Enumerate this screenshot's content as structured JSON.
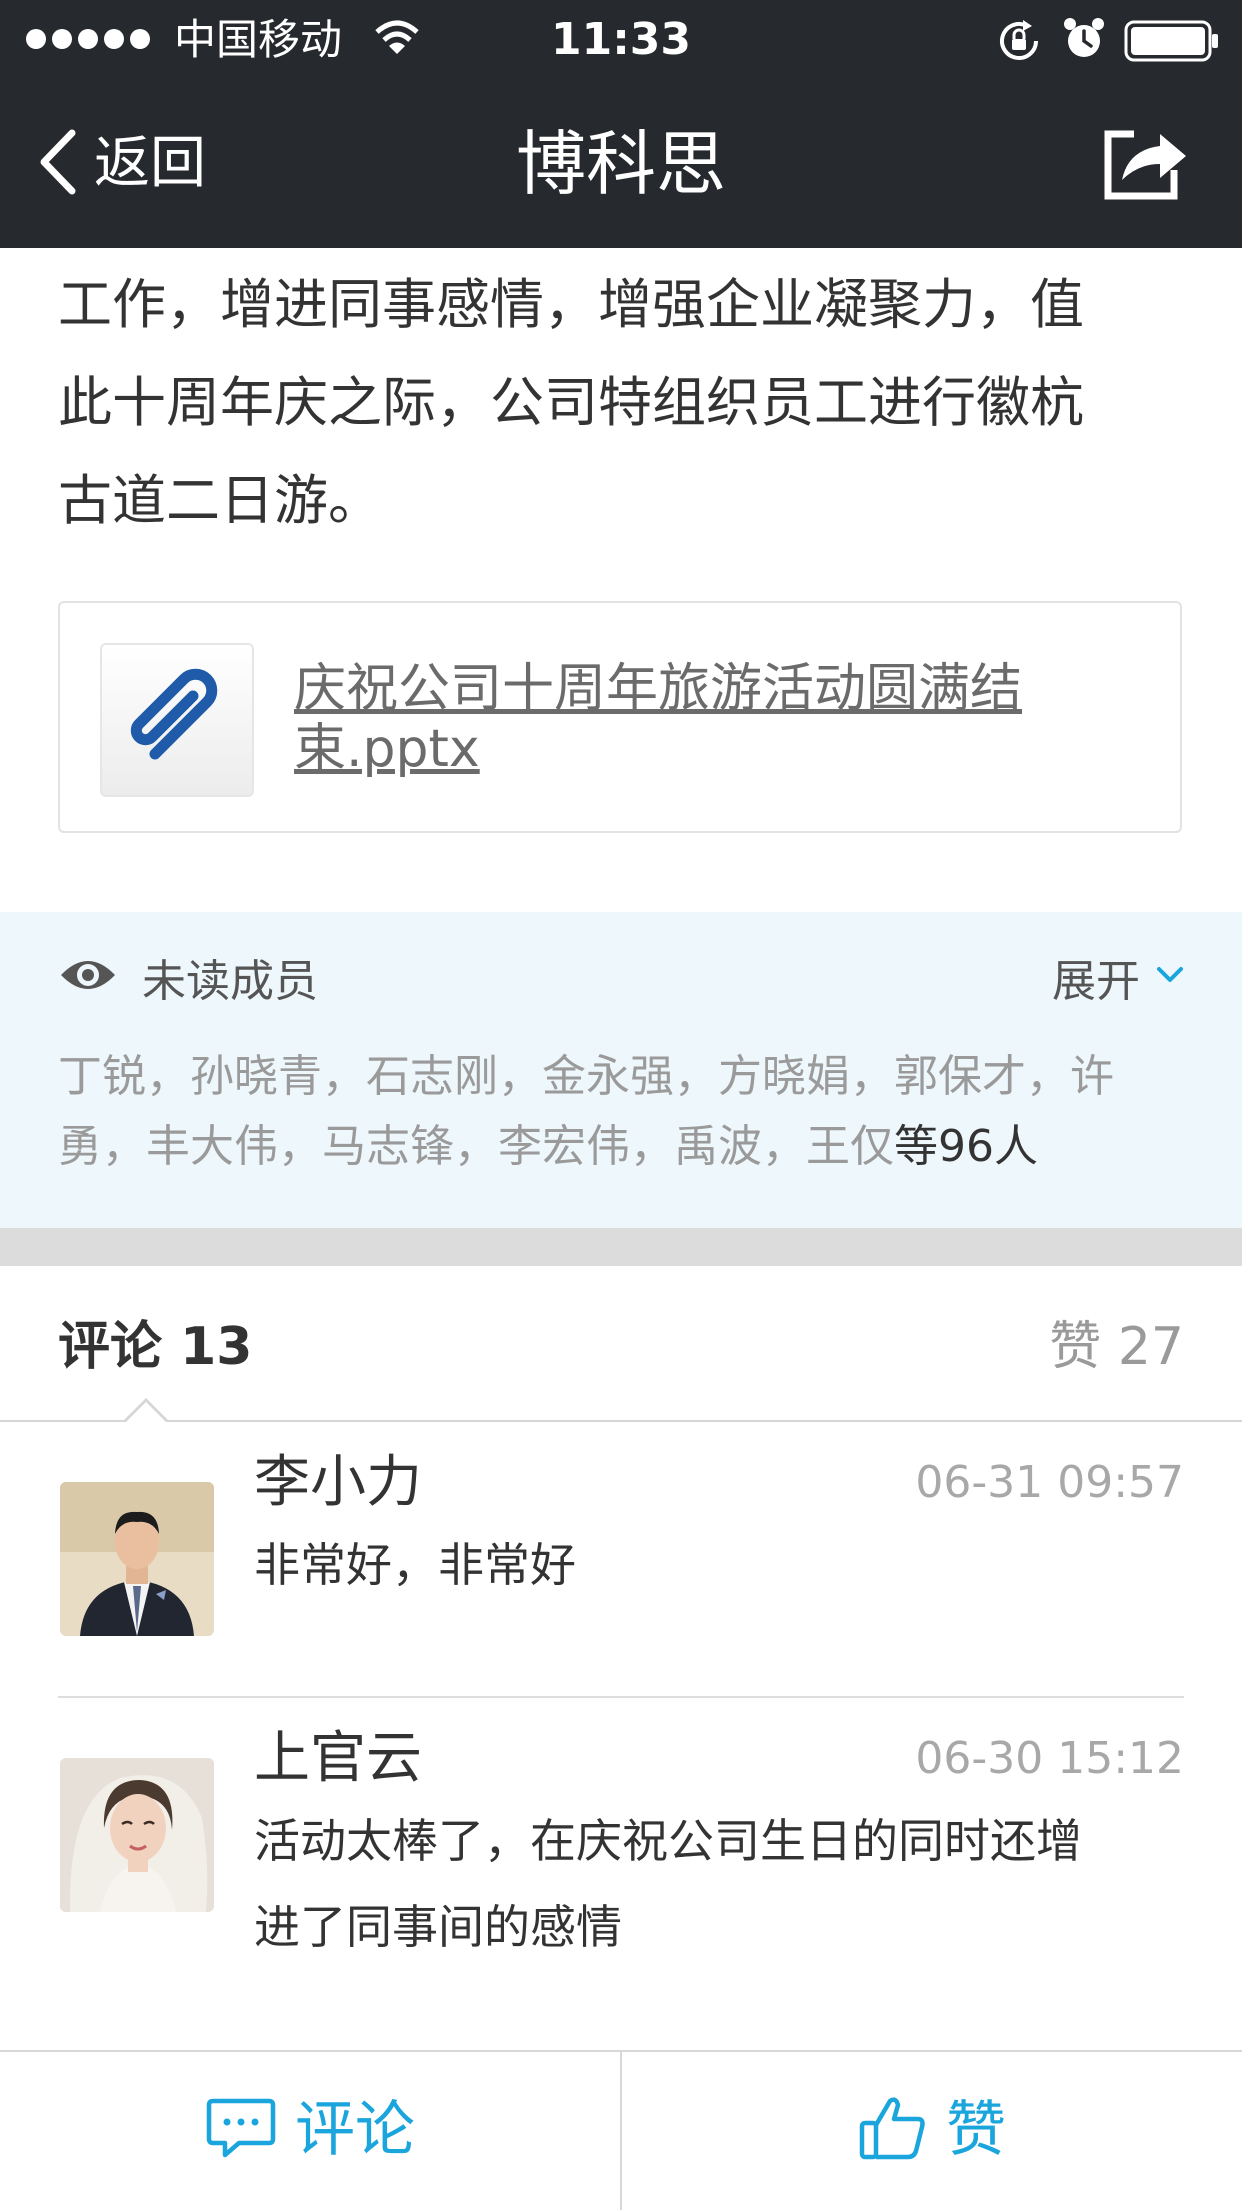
{
  "status_bar": {
    "carrier": "中国移动",
    "time": "11:33"
  },
  "nav": {
    "back_label": "返回",
    "title": "博科思"
  },
  "article": {
    "lines": [
      "工作，增进同事感情，增强企业凝聚力，值",
      "此十周年庆之际，公司特组织员工进行徽杭",
      "古道二日游。"
    ]
  },
  "attachment": {
    "file_name": "庆祝公司十周年旅游活动圆满结束.pptx"
  },
  "unread": {
    "title": "未读成员",
    "expand_label": "展开",
    "names_line1": "丁锐，孙晓青，石志刚，金永强，方晓娟，郭保才，许",
    "names_line2": "勇，丰大伟，马志锋，李宏伟，禹波，王仅",
    "count_text": "等96人"
  },
  "tabs": {
    "comments_label": "评论 13",
    "likes_label": "赞 27"
  },
  "comments": [
    {
      "name": "李小力",
      "time": "06-31 09:57",
      "lines": [
        "非常好，非常好"
      ]
    },
    {
      "name": "上官云",
      "time": "06-30 15:12",
      "lines": [
        "活动太棒了，在庆祝公司生日的同时还增",
        "进了同事间的感情"
      ]
    }
  ],
  "bottom_bar": {
    "comment_label": "评论",
    "like_label": "赞"
  },
  "colors": {
    "nav_background": "#26292d",
    "accent": "#1aa5dd",
    "unread_background": "#eef7fb",
    "attachment_icon": "#1f5ba8"
  }
}
